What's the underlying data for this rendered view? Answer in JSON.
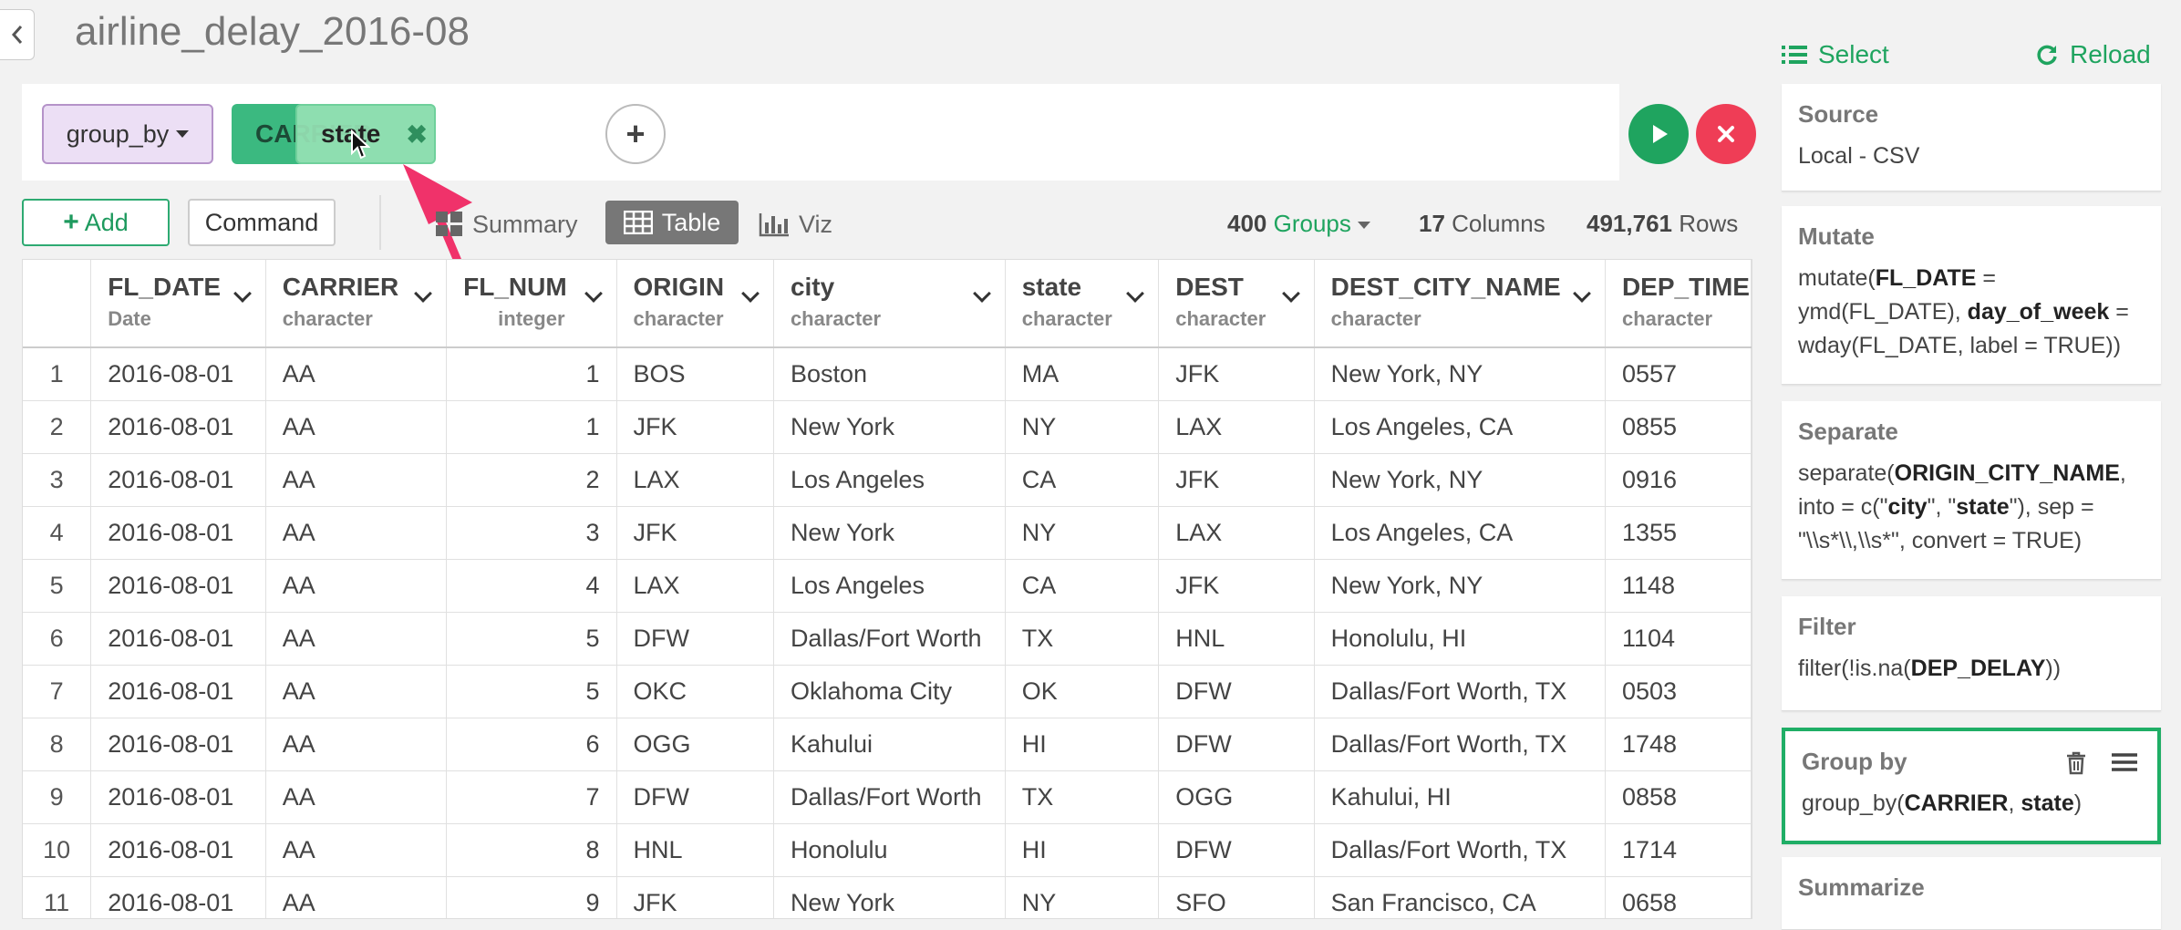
{
  "page": {
    "title": "airline_delay_2016-08"
  },
  "command_bar": {
    "command_dropdown": "group_by",
    "chip_carrier": "CARRIER",
    "chip_state": "state",
    "chip_close": "✖"
  },
  "toolbar": {
    "add_label": "Add",
    "command_label": "Command",
    "tab_summary": "Summary",
    "tab_table": "Table",
    "tab_viz": "Viz",
    "groups_count": "400",
    "groups_label": "Groups",
    "columns_count": "17",
    "columns_label": "Columns",
    "rows_count": "491,761",
    "rows_label": "Rows"
  },
  "table": {
    "columns": [
      {
        "name": "FL_DATE",
        "type": "Date"
      },
      {
        "name": "CARRIER",
        "type": "character"
      },
      {
        "name": "FL_NUM",
        "type": "integer"
      },
      {
        "name": "ORIGIN",
        "type": "character"
      },
      {
        "name": "city",
        "type": "character"
      },
      {
        "name": "state",
        "type": "character"
      },
      {
        "name": "DEST",
        "type": "character"
      },
      {
        "name": "DEST_CITY_NAME",
        "type": "character"
      },
      {
        "name": "DEP_TIME",
        "type": "character"
      }
    ],
    "rows": [
      [
        "1",
        "2016-08-01",
        "AA",
        "1",
        "BOS",
        "Boston",
        "MA",
        "JFK",
        "New York, NY",
        "0557"
      ],
      [
        "2",
        "2016-08-01",
        "AA",
        "1",
        "JFK",
        "New York",
        "NY",
        "LAX",
        "Los Angeles, CA",
        "0855"
      ],
      [
        "3",
        "2016-08-01",
        "AA",
        "2",
        "LAX",
        "Los Angeles",
        "CA",
        "JFK",
        "New York, NY",
        "0916"
      ],
      [
        "4",
        "2016-08-01",
        "AA",
        "3",
        "JFK",
        "New York",
        "NY",
        "LAX",
        "Los Angeles, CA",
        "1355"
      ],
      [
        "5",
        "2016-08-01",
        "AA",
        "4",
        "LAX",
        "Los Angeles",
        "CA",
        "JFK",
        "New York, NY",
        "1148"
      ],
      [
        "6",
        "2016-08-01",
        "AA",
        "5",
        "DFW",
        "Dallas/Fort Worth",
        "TX",
        "HNL",
        "Honolulu, HI",
        "1104"
      ],
      [
        "7",
        "2016-08-01",
        "AA",
        "5",
        "OKC",
        "Oklahoma City",
        "OK",
        "DFW",
        "Dallas/Fort Worth, TX",
        "0503"
      ],
      [
        "8",
        "2016-08-01",
        "AA",
        "6",
        "OGG",
        "Kahului",
        "HI",
        "DFW",
        "Dallas/Fort Worth, TX",
        "1748"
      ],
      [
        "9",
        "2016-08-01",
        "AA",
        "7",
        "DFW",
        "Dallas/Fort Worth",
        "TX",
        "OGG",
        "Kahului, HI",
        "0858"
      ],
      [
        "10",
        "2016-08-01",
        "AA",
        "8",
        "HNL",
        "Honolulu",
        "HI",
        "DFW",
        "Dallas/Fort Worth, TX",
        "1714"
      ],
      [
        "11",
        "2016-08-01",
        "AA",
        "9",
        "JFK",
        "New York",
        "NY",
        "SFO",
        "San Francisco, CA",
        "0658"
      ]
    ]
  },
  "panel": {
    "select_label": "Select",
    "reload_label": "Reload",
    "steps": [
      {
        "title": "Source",
        "body": "Local - CSV"
      },
      {
        "title": "Mutate"
      },
      {
        "title": "Separate"
      },
      {
        "title": "Filter"
      },
      {
        "title": "Group by"
      },
      {
        "title": "Summarize"
      }
    ]
  },
  "colors": {
    "accent": "#1fa45f",
    "cancel": "#ef3d56",
    "arrow": "#f0326a",
    "command_chip": "#ecdff5"
  }
}
